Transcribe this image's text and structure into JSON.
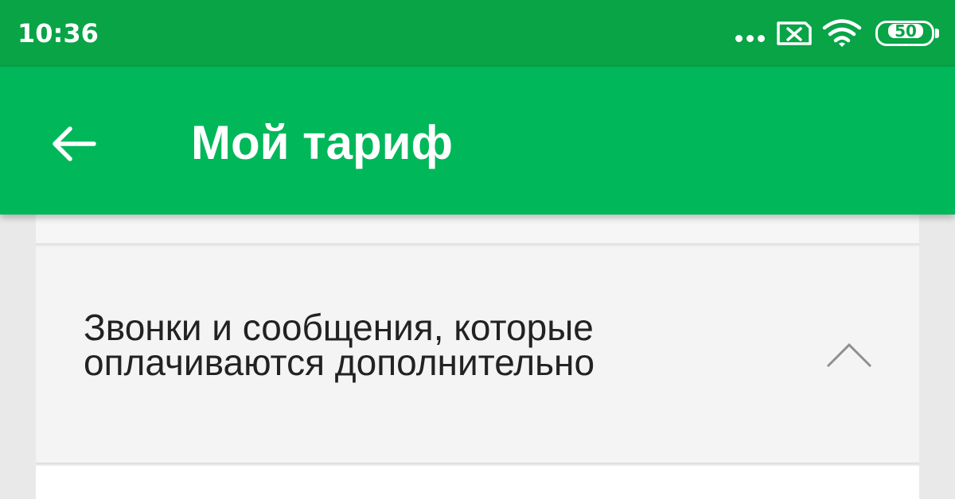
{
  "status_bar": {
    "time": "10:36",
    "battery": "50",
    "icons": [
      "more-dots-icon",
      "sim-card-icon",
      "wifi-icon",
      "battery-icon"
    ]
  },
  "app_bar": {
    "title": "Мой тариф",
    "back_icon": "arrow-back-icon"
  },
  "section": {
    "title_line1": "Звонки и сообщения, которые",
    "title_line2": "оплачиваются дополнительно",
    "toggle_icon": "chevron-up-icon",
    "expanded": true
  },
  "colors": {
    "status_bar_bg": "#08a446",
    "app_bar_bg": "#00b75a",
    "text": "#222222"
  }
}
